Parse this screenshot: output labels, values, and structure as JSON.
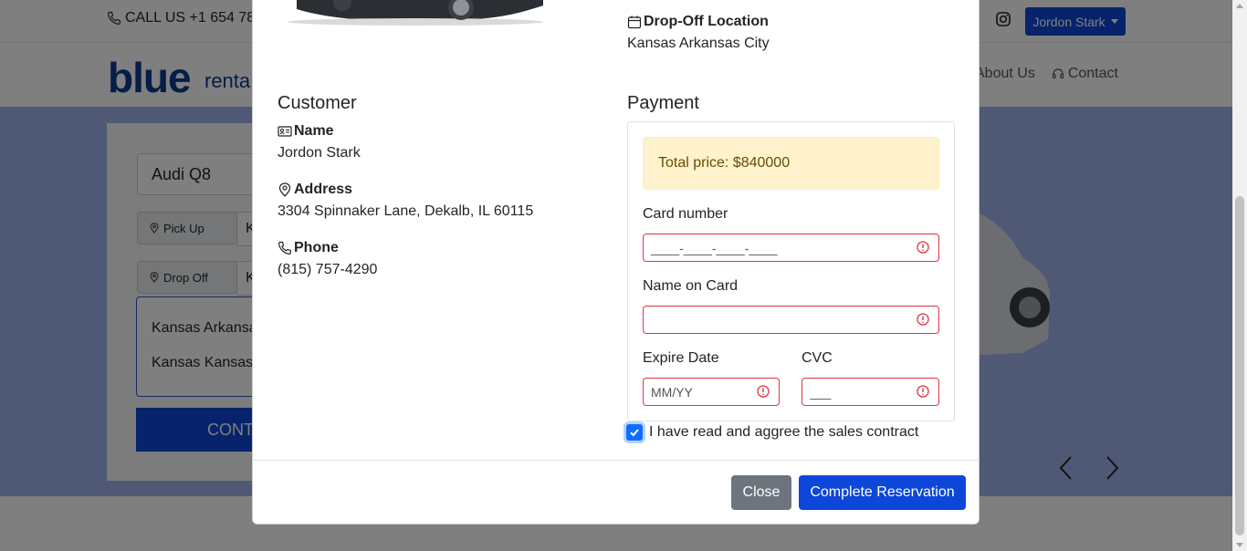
{
  "topbar": {
    "call_text": "CALL US +1 654 78",
    "user_name": "Jordon Stark"
  },
  "nav": {
    "logo_text": "blue",
    "logo_sub": "renta",
    "about": "About Us",
    "contact": "Contact"
  },
  "search": {
    "car": "Audi Q8",
    "pickup_label": "Pick Up",
    "dropoff_label": "Drop Off",
    "pickup_value": "K",
    "dropoff_value": "K",
    "locations": [
      "Kansas Arkansa",
      "Kansas Kansas"
    ],
    "continue_label": "CONT"
  },
  "modal": {
    "dropoff": {
      "title": "Drop-Off Location",
      "value": "Kansas Arkansas City"
    },
    "customer": {
      "heading": "Customer",
      "name_label": "Name",
      "name_value": "Jordon Stark",
      "address_label": "Address",
      "address_value": "3304 Spinnaker Lane, Dekalb, IL 60115",
      "phone_label": "Phone",
      "phone_value": "(815) 757-4290"
    },
    "payment": {
      "heading": "Payment",
      "total": "Total price: $840000",
      "card_number_label": "Card number",
      "card_number_placeholder": "____-____-____-____",
      "name_on_card_label": "Name on Card",
      "name_on_card_value": "",
      "expire_label": "Expire Date",
      "expire_placeholder": "MM/YY",
      "cvc_label": "CVC",
      "cvc_placeholder": "___"
    },
    "agree_label": "I have read and aggree the sales contract",
    "agree_checked": true,
    "close_label": "Close",
    "complete_label": "Complete Reservation"
  },
  "colors": {
    "primary": "#0d47d9",
    "error": "#dc3545",
    "alert_bg": "#fff3cd",
    "hero_bg": "#9fb3ea"
  }
}
